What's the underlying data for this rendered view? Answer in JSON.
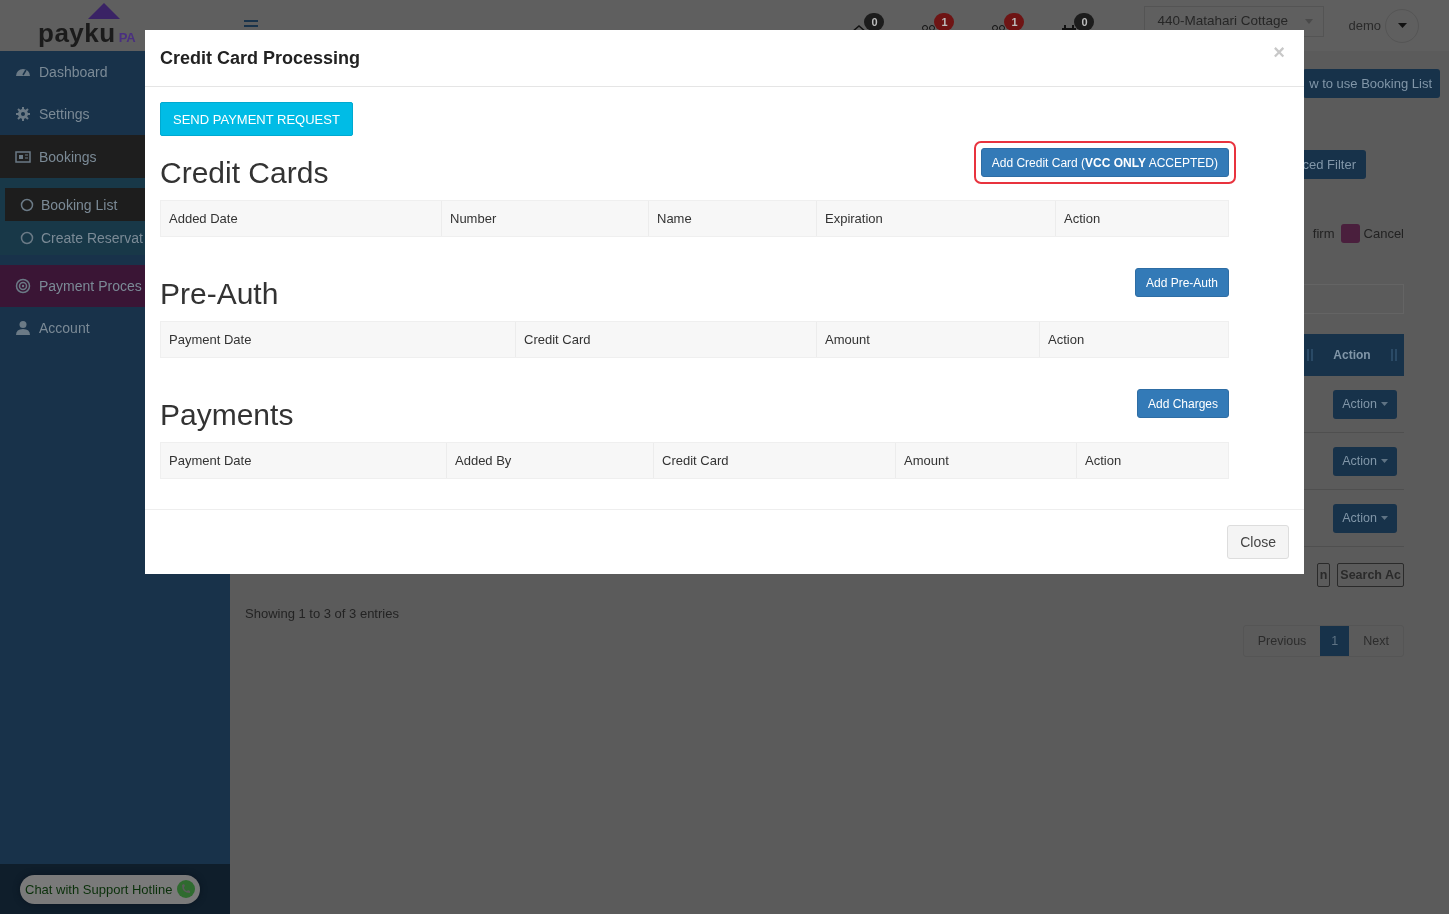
{
  "header": {
    "logo": {
      "wordmark": "payku",
      "suffix": "PA"
    },
    "notifications": [
      {
        "count": "0",
        "color": "#1c1c1c"
      },
      {
        "count": "1",
        "color": "#6e1414"
      },
      {
        "count": "1",
        "color": "#6e1414"
      },
      {
        "count": "0",
        "color": "#1c1c1c"
      }
    ],
    "property_select": {
      "value": "440-Matahari Cottage"
    },
    "user": {
      "name": "demo"
    }
  },
  "sidebar": {
    "items": [
      {
        "label": "Dashboard",
        "selected": false,
        "expanded": false
      },
      {
        "label": "Settings",
        "selected": false,
        "expanded": false
      },
      {
        "label": "Bookings",
        "selected": false,
        "expanded": true,
        "children": [
          {
            "label": "Booking List",
            "selected": true
          },
          {
            "label": "Create Reservat",
            "selected": false
          }
        ]
      },
      {
        "label": "Payment Proces",
        "selected": true,
        "expanded": false
      },
      {
        "label": "Account",
        "selected": false,
        "expanded": false
      }
    ],
    "chat_button": "Chat with Support Hotline"
  },
  "main": {
    "help_button": "w to use Booking List",
    "filter_button": "ced Filter",
    "legend": [
      {
        "label": "firm"
      },
      {
        "label": "Cancel",
        "color": "#4a1f3d"
      }
    ],
    "table": {
      "columns": [
        "Action"
      ],
      "rows": [
        {
          "action": "Action"
        },
        {
          "action": "Action"
        },
        {
          "action": "Action"
        }
      ]
    },
    "export_buttons": [
      "n",
      "Search Ac"
    ],
    "info": "Showing 1 to 3 of 3 entries",
    "pagination": {
      "previous": "Previous",
      "pages": [
        {
          "label": "1",
          "selected": true
        }
      ],
      "next": "Next"
    }
  },
  "modal": {
    "title": "Credit Card Processing",
    "close": "×",
    "send_button": "SEND PAYMENT REQUEST",
    "sections": [
      {
        "title": "Credit Cards",
        "action": "Add Credit Card (**VCC ONLY** ACCEPTED)",
        "highlighted": true,
        "columns": [
          "Added Date",
          "Number",
          "Name",
          "Expiration",
          "Action"
        ]
      },
      {
        "title": "Pre-Auth",
        "action": "Add Pre-Auth",
        "highlighted": false,
        "columns": [
          "Payment Date",
          "Credit Card",
          "Amount",
          "Action"
        ]
      },
      {
        "title": "Payments",
        "action": "Add Charges",
        "highlighted": false,
        "columns": [
          "Payment Date",
          "Added By",
          "Credit Card",
          "Amount",
          "Action"
        ]
      }
    ],
    "footer_button": "Close"
  }
}
